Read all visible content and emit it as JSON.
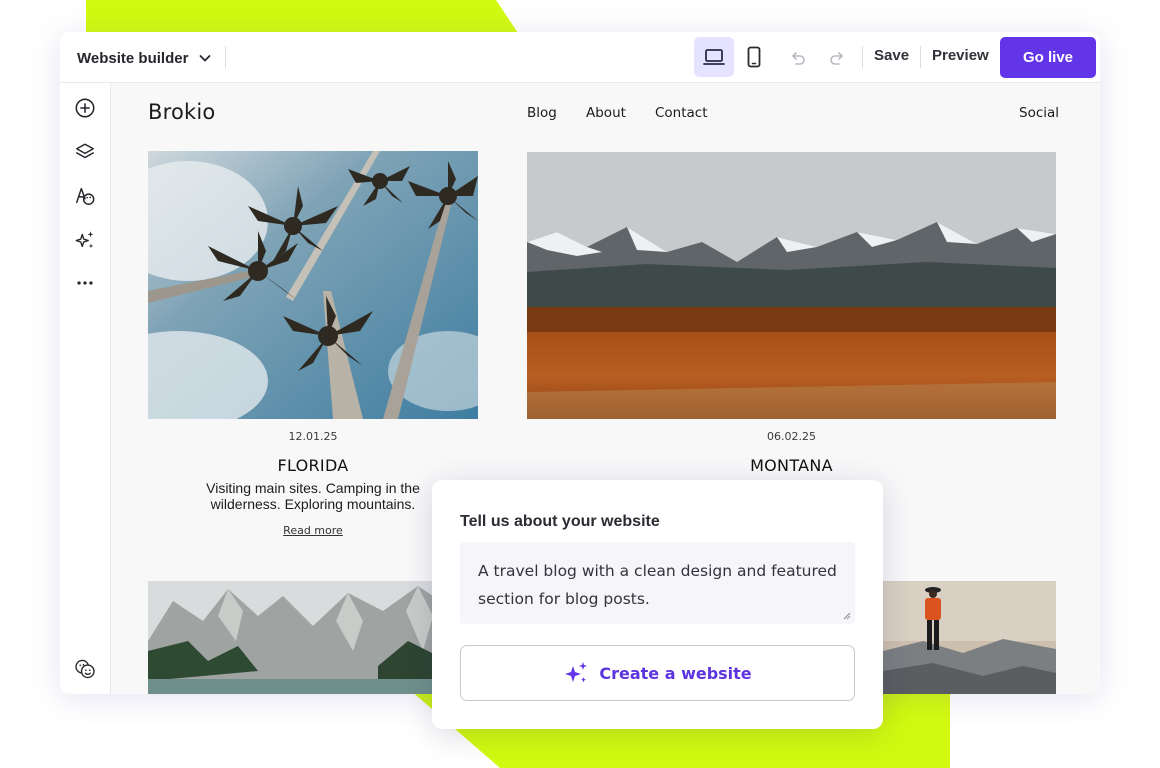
{
  "toolbar": {
    "site_selector": "Website builder",
    "save_label": "Save",
    "preview_label": "Preview",
    "golive_label": "Go live",
    "accent_color": "#6236e8"
  },
  "sidebar": {
    "items": [
      {
        "icon": "add-circle-icon"
      },
      {
        "icon": "layers-icon"
      },
      {
        "icon": "typography-palette-icon"
      },
      {
        "icon": "sparkles-icon"
      },
      {
        "icon": "more-dots-icon"
      },
      {
        "icon": "accessibility-faces-icon"
      }
    ]
  },
  "site": {
    "brand": "Brokio",
    "nav": [
      "Blog",
      "About",
      "Contact"
    ],
    "social": "Social",
    "posts": [
      {
        "date": "12.01.25",
        "title": "FLORIDA",
        "excerpt_line1": "Visiting main sites. Camping in the",
        "excerpt_line2": "wilderness. Exploring mountains.",
        "link": "Read more",
        "image": "palm-trees-photo"
      },
      {
        "date": "06.02.25",
        "title": "MONTANA",
        "image": "mountains-field-photo"
      },
      {
        "image": "rocky-peaks-lake-photo"
      },
      {
        "image": "hiker-on-rocks-photo"
      }
    ]
  },
  "prompt": {
    "heading": "Tell us about your website",
    "text": "A travel blog with a clean design and featured section for blog posts.",
    "button_label": "Create a website",
    "highlight_color": "#d2fa10"
  }
}
